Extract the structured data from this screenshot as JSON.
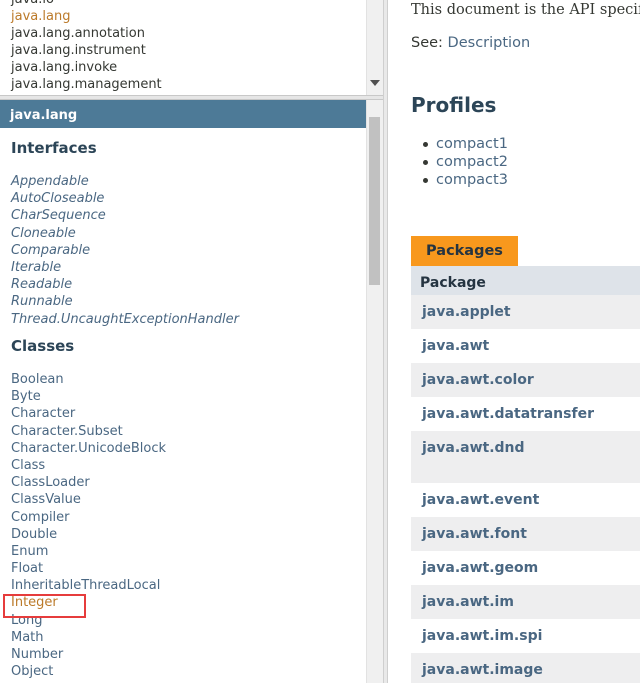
{
  "package_list": {
    "items": [
      {
        "label": "java.io",
        "visited": false
      },
      {
        "label": "java.lang",
        "visited": true
      },
      {
        "label": "java.lang.annotation",
        "visited": false
      },
      {
        "label": "java.lang.instrument",
        "visited": false
      },
      {
        "label": "java.lang.invoke",
        "visited": false
      },
      {
        "label": "java.lang.management",
        "visited": false
      }
    ]
  },
  "class_frame": {
    "title": "java.lang",
    "interfaces_heading": "Interfaces",
    "interfaces": [
      "Appendable",
      "AutoCloseable",
      "CharSequence",
      "Cloneable",
      "Comparable",
      "Iterable",
      "Readable",
      "Runnable",
      "Thread.UncaughtExceptionHandler"
    ],
    "classes_heading": "Classes",
    "classes": [
      {
        "label": "Boolean",
        "visited": false
      },
      {
        "label": "Byte",
        "visited": false
      },
      {
        "label": "Character",
        "visited": false
      },
      {
        "label": "Character.Subset",
        "visited": false
      },
      {
        "label": "Character.UnicodeBlock",
        "visited": false
      },
      {
        "label": "Class",
        "visited": false
      },
      {
        "label": "ClassLoader",
        "visited": false
      },
      {
        "label": "ClassValue",
        "visited": false
      },
      {
        "label": "Compiler",
        "visited": false
      },
      {
        "label": "Double",
        "visited": false
      },
      {
        "label": "Enum",
        "visited": false
      },
      {
        "label": "Float",
        "visited": false
      },
      {
        "label": "InheritableThreadLocal",
        "visited": false
      },
      {
        "label": "Integer",
        "visited": true
      },
      {
        "label": "Long",
        "visited": false
      },
      {
        "label": "Math",
        "visited": false
      },
      {
        "label": "Number",
        "visited": false
      },
      {
        "label": "Object",
        "visited": false
      }
    ]
  },
  "content": {
    "intro_text": "This document is the API specification",
    "see_label": "See:",
    "see_link": "Description",
    "profiles_heading": "Profiles",
    "profiles": [
      "compact1",
      "compact2",
      "compact3"
    ],
    "packages_tab": "Packages",
    "table_header": "Package",
    "packages": [
      {
        "name": "java.applet"
      },
      {
        "name": "java.awt"
      },
      {
        "name": "java.awt.color"
      },
      {
        "name": "java.awt.datatransfer"
      },
      {
        "name": "java.awt.dnd"
      },
      {
        "name": "java.awt.event"
      },
      {
        "name": "java.awt.font"
      },
      {
        "name": "java.awt.geom"
      },
      {
        "name": "java.awt.im"
      },
      {
        "name": "java.awt.im.spi"
      },
      {
        "name": "java.awt.image"
      }
    ]
  },
  "colors": {
    "header_blue": "#4d7a97",
    "tab_orange": "#f8981d",
    "link_blue": "#4a6782",
    "visited_link": "#bb7a2a",
    "highlight_red": "#e63c3c"
  }
}
